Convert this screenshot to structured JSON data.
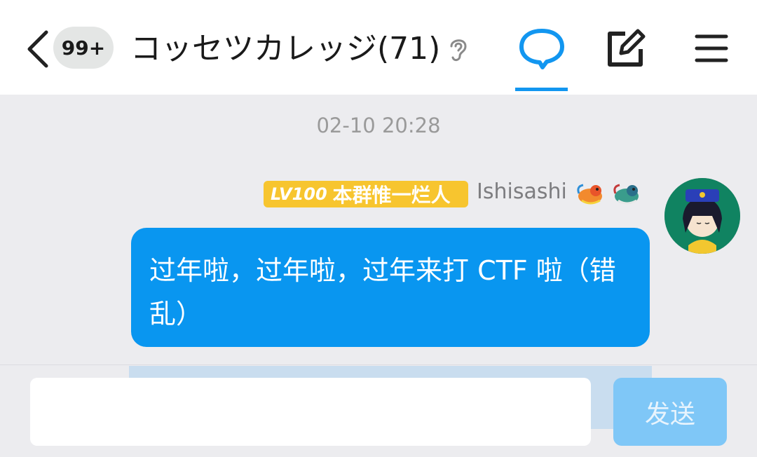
{
  "header": {
    "back_icon": "chevron-left-icon",
    "unread_count": "99+",
    "group_title": "コッセツカレッジ(71)",
    "listen_icon": "ear-icon",
    "chat_icon": "chat-bubble-icon",
    "edit_icon": "edit-square-icon",
    "menu_icon": "hamburger-menu-icon",
    "accent_color": "#1296f0"
  },
  "messages": [
    {
      "timestamp": "02-10 20:28",
      "level": "LV100",
      "member_title": "本群惟一烂人",
      "sender": "Ishisashi",
      "badges": [
        "dragon-badge-icon",
        "dragon-badge-icon"
      ],
      "text": "过年啦，过年啦，过年来打 CTF 啦（错乱）",
      "bubble_color": "#0996f0"
    }
  ],
  "input": {
    "value": "",
    "placeholder": ""
  },
  "send_label": "发送"
}
